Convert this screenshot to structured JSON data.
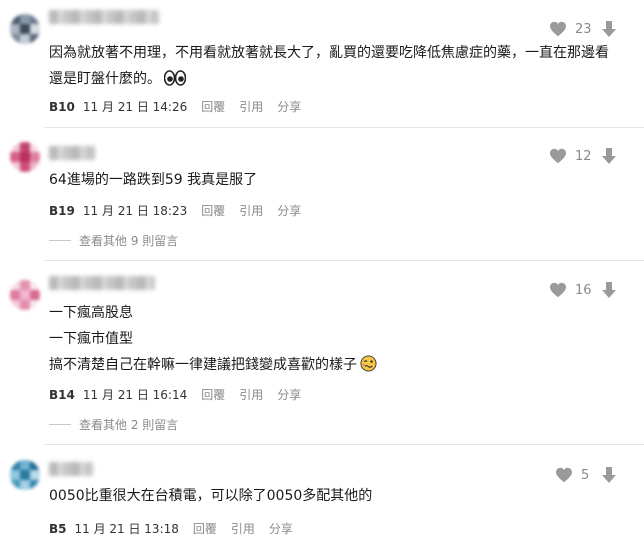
{
  "colors": {
    "text": "#1a1a1a",
    "muted": "#8a8a8a",
    "divider": "#e5e5e5",
    "icon": "#9a9a9a"
  },
  "icons": {
    "like": "heart-icon",
    "dislike": "down-arrow-icon",
    "emoji_eyes": "eyes-emoji",
    "emoji_woozy": "woozy-face-emoji"
  },
  "actions": {
    "reply": "回覆",
    "quote": "引用",
    "share": "分享"
  },
  "comments": [
    {
      "likes": "23",
      "lines": [
        "因為就放著不用理，不用看就放著就長大了，亂買的還要吃降低焦慮症的藥，一直在那邊看",
        "還是盯盤什麼的。"
      ],
      "floor": "B10",
      "time": "11 月 21 日 14:26",
      "replies": ""
    },
    {
      "likes": "12",
      "lines": [
        "64進場的一路跌到59 我真是服了"
      ],
      "floor": "B19",
      "time": "11 月 21 日 18:23",
      "replies": "查看其他 9 則留言"
    },
    {
      "likes": "16",
      "lines": [
        "一下瘋高股息",
        "一下瘋市值型",
        "搞不清楚自己在幹嘛一律建議把錢變成喜歡的樣子"
      ],
      "floor": "B14",
      "time": "11 月 21 日 16:14",
      "replies": "查看其他 2 則留言"
    },
    {
      "likes": "5",
      "lines": [
        "0050比重很大在台積電，可以除了0050多配其他的"
      ],
      "floor": "B5",
      "time": "11 月 21 日 13:18",
      "replies": ""
    }
  ]
}
